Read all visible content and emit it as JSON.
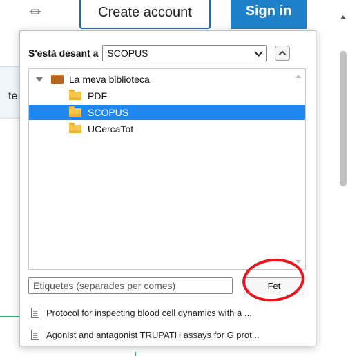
{
  "background": {
    "create_account": "Create account",
    "sign_in": "Sign in",
    "tab_fragment": "te"
  },
  "panel": {
    "save_label": "S'està desant a",
    "target_value": "SCOPUS",
    "tree": [
      {
        "label": "La meva biblioteca",
        "type": "library",
        "expanded": true
      },
      {
        "label": "PDF",
        "type": "folder"
      },
      {
        "label": "SCOPUS",
        "type": "folder",
        "selected": true
      },
      {
        "label": "UCercaTot",
        "type": "folder"
      }
    ],
    "tags_placeholder": "Etiquetes (separades per comes)",
    "done_label": "Fet",
    "items": [
      "Protocol for inspecting blood cell dynamics with a ...",
      "Agonist and antagonist TRUPATH assays for G prot..."
    ]
  },
  "colors": {
    "selection": "#1e87f0",
    "annotation_circle": "#e8141e",
    "brand_blue": "#1e80c8"
  },
  "icons": [
    "library-icon",
    "folder-icon",
    "document-icon",
    "chevron-down-icon",
    "chevron-up-icon"
  ]
}
